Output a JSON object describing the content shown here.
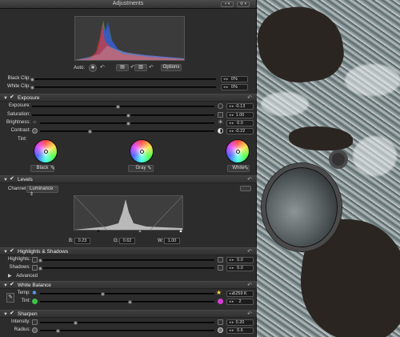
{
  "window": {
    "title": "Adjustments",
    "menu_plus": "+ ▾",
    "menu_gear": "⚙ ▾"
  },
  "histogram_controls": {
    "auto_label": "Auto:",
    "options_label": "Options"
  },
  "clip": [
    {
      "label": "Black Clip:",
      "value": "0%"
    },
    {
      "label": "White Clip:",
      "value": "0%"
    }
  ],
  "exposure": {
    "section": "Exposure",
    "rows": [
      {
        "label": "Exposure:",
        "value": "-0.13"
      },
      {
        "label": "Saturation:",
        "value": "1.00"
      },
      {
        "label": "Brightness:",
        "value": "0.0"
      },
      {
        "label": "Contrast:",
        "value": "-0.22"
      }
    ],
    "tint_label": "Tint:",
    "wheels": [
      {
        "label": "Black"
      },
      {
        "label": "Gray"
      },
      {
        "label": "White"
      }
    ]
  },
  "levels": {
    "section": "Levels",
    "channel_label": "Channel:",
    "channel_value": "Luminance",
    "b_label": "B:",
    "b_value": "0.23",
    "g_label": "G:",
    "g_value": "0.62",
    "w_label": "W:",
    "w_value": "1.00"
  },
  "highlights_shadows": {
    "section": "Highlights & Shadows",
    "rows": [
      {
        "label": "Highlights:",
        "value": "0.0"
      },
      {
        "label": "Shadows:",
        "value": "0.0"
      }
    ],
    "advanced_label": "Advanced"
  },
  "white_balance": {
    "section": "White Balance",
    "rows": [
      {
        "label": "Temp:",
        "value": "5259 K"
      },
      {
        "label": "Tint:",
        "value": "2"
      }
    ]
  },
  "sharpen": {
    "section": "Sharpen",
    "rows": [
      {
        "label": "Intensity:",
        "value": "0.20"
      },
      {
        "label": "Radius:",
        "value": "0.6"
      }
    ]
  }
}
